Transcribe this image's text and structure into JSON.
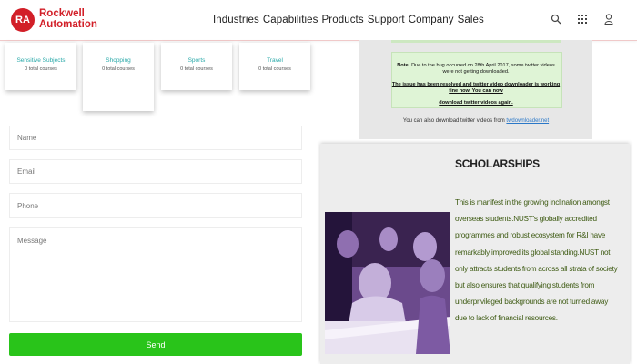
{
  "header": {
    "logo_badge": "RA",
    "logo_line1": "Rockwell",
    "logo_line2": "Automation",
    "nav": [
      "Industries",
      "Capabilities",
      "Products",
      "Support",
      "Company",
      "Sales"
    ],
    "icons": [
      "search-icon",
      "grid-icon",
      "user-icon"
    ]
  },
  "categories": [
    {
      "title": "Sensitive Subjects",
      "count": "0 total courses"
    },
    {
      "title": "Shopping",
      "count": "0 total courses"
    },
    {
      "title": "Sports",
      "count": "0 total courses"
    },
    {
      "title": "Travel",
      "count": "0 total courses"
    }
  ],
  "form": {
    "name_placeholder": "Name",
    "email_placeholder": "Email",
    "phone_placeholder": "Phone",
    "message_placeholder": "Message",
    "send_label": "Send"
  },
  "notice": {
    "note_label": "Note:",
    "note_text": "Due to the bug occurred on 28th April 2017, some twitter videos were not getting downloaded.",
    "resolved_line1": "The issue has been resolved and twitter video downloader is working fine now. You can now",
    "resolved_line2": "download twitter videos again.",
    "also_text": "You can also download twitter videos from",
    "also_link": "twdownloader.net"
  },
  "scholarships": {
    "title": "SCHOLARSHIPS",
    "body": "This is manifest in the growing inclination amongst overseas students.NUST's globally accredited programmes and robust ecosystem for R&I have remarkably improved its global standing.NUST not only attracts students from across all strata of society but also ensures that qualifying students from underprivileged backgrounds are not turned away due to lack of financial resources."
  },
  "colors": {
    "brand": "#d21f28",
    "send": "#29c41a",
    "category_title": "#2aa9a9",
    "body_text": "#3d5a12"
  }
}
